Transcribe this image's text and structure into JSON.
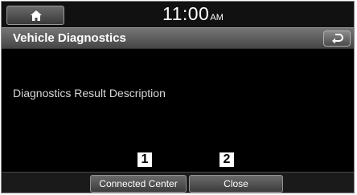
{
  "status_bar": {
    "home_icon": "home-icon",
    "time": "11:00",
    "ampm": "AM"
  },
  "header": {
    "title": "Vehicle Diagnostics",
    "back_icon": "back-arrow-icon"
  },
  "content": {
    "description": "Diagnostics Result Description"
  },
  "bottom_bar": {
    "buttons": [
      {
        "label": "Connected Center",
        "callout": "1"
      },
      {
        "label": "Close",
        "callout": "2"
      }
    ]
  }
}
